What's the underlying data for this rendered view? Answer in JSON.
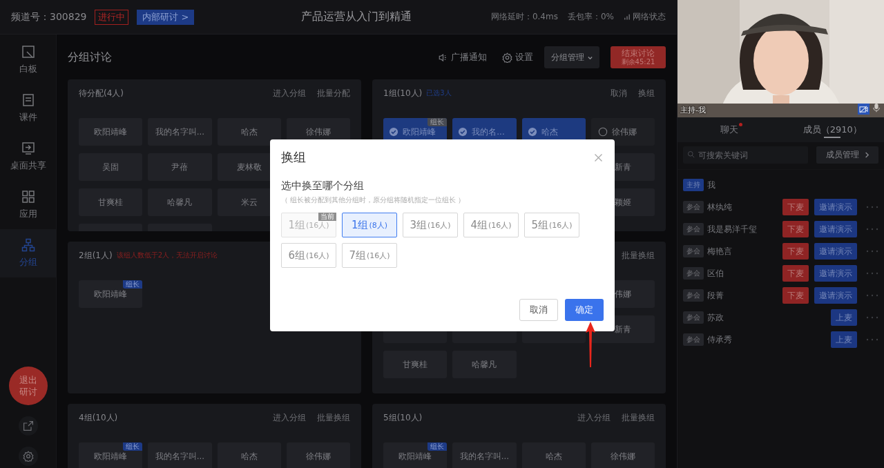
{
  "top_bar": {
    "channel": "频道号：300829",
    "status": "进行中",
    "meeting_tag": "内部研讨 >",
    "title": "产品运营从入门到精通",
    "latency": "网络延时：0.4ms",
    "packet_loss": "丢包率：0%",
    "network": "网络状态"
  },
  "sidebar": {
    "items": [
      {
        "kind": "whiteboard",
        "label": "白板",
        "selected": false
      },
      {
        "kind": "courseware",
        "label": "课件",
        "selected": false
      },
      {
        "kind": "screen-share",
        "label": "桌面共享",
        "selected": false
      },
      {
        "kind": "apps",
        "label": "应用",
        "selected": false
      },
      {
        "kind": "groups",
        "label": "分组",
        "selected": true
      }
    ],
    "exit_button": "退出研讨"
  },
  "header": {
    "title": "分组讨论",
    "broadcast": "广播通知",
    "settings": "设置",
    "group_menu": "分组管理",
    "end_button": "结束讨论",
    "remaining": "剩余45:21"
  },
  "groups": [
    {
      "title": "待分配(4人)",
      "actions": [
        "进入分组",
        "批量分配"
      ],
      "members": [
        {
          "kind": "plain",
          "name": "欧阳靖峰"
        },
        {
          "kind": "plain",
          "name": "我的名字叫..."
        },
        {
          "kind": "plain",
          "name": "哈杰"
        },
        {
          "kind": "plain",
          "name": "徐伟娜"
        },
        {
          "kind": "plain",
          "name": "吴固"
        },
        {
          "kind": "plain",
          "name": "尹蓓"
        },
        {
          "kind": "plain",
          "name": "麦林敬"
        },
        {
          "kind": "hidden"
        },
        {
          "kind": "plain",
          "name": "甘爽桂"
        },
        {
          "kind": "plain",
          "name": "哈馨凡"
        },
        {
          "kind": "plain",
          "name": "米云"
        },
        {
          "kind": "hidden"
        },
        {
          "kind": "blank"
        },
        {
          "kind": "blank"
        }
      ]
    },
    {
      "title": "1组(10人)",
      "note": "已选3人",
      "actions": [
        "取消",
        "换组"
      ],
      "members": [
        {
          "kind": "selectable",
          "name": "欧阳靖峰",
          "badge": "组长",
          "selected": true
        },
        {
          "kind": "selectable",
          "name": "我的名...",
          "selected": true
        },
        {
          "kind": "selectable",
          "name": "哈杰",
          "selected": true
        },
        {
          "kind": "selectable",
          "name": "徐伟娜",
          "selected": false
        },
        {
          "kind": "hidden"
        },
        {
          "kind": "hidden"
        },
        {
          "kind": "hidden"
        },
        {
          "kind": "plain",
          "name": "新青"
        },
        {
          "kind": "hidden"
        },
        {
          "kind": "hidden"
        },
        {
          "kind": "hidden"
        },
        {
          "kind": "plain",
          "name": "颖姬"
        }
      ]
    },
    {
      "title": "2组(1人)",
      "warning": "该组人数低于2人，无法开启讨论",
      "members": [
        {
          "kind": "plain",
          "name": "欧阳靖峰",
          "badge": "组长"
        }
      ]
    },
    {
      "actions": [
        "批量换组"
      ],
      "members": [
        {
          "kind": "hidden"
        },
        {
          "kind": "hidden"
        },
        {
          "kind": "hidden"
        },
        {
          "kind": "plain",
          "name": "伟娜"
        },
        {
          "kind": "covered"
        },
        {
          "kind": "covered"
        },
        {
          "kind": "covered"
        },
        {
          "kind": "plain",
          "name": "新青"
        },
        {
          "kind": "plain",
          "name": "甘爽桂"
        },
        {
          "kind": "plain",
          "name": "哈馨凡"
        }
      ]
    },
    {
      "title": "4组(10人)",
      "actions": [
        "进入分组",
        "批量换组"
      ],
      "members": [
        {
          "kind": "plain",
          "name": "欧阳靖峰",
          "badge": "组长"
        },
        {
          "kind": "plain",
          "name": "我的名字叫..."
        },
        {
          "kind": "plain",
          "name": "哈杰"
        },
        {
          "kind": "plain",
          "name": "徐伟娜"
        }
      ]
    },
    {
      "title": "5组(10人)",
      "actions": [
        "进入分组",
        "批量换组"
      ],
      "members": [
        {
          "kind": "plain",
          "name": "欧阳靖峰",
          "badge": "组长"
        },
        {
          "kind": "plain",
          "name": "我的名字叫..."
        },
        {
          "kind": "plain",
          "name": "哈杰"
        },
        {
          "kind": "plain",
          "name": "徐伟娜"
        }
      ]
    }
  ],
  "video": {
    "kind": "picture",
    "label": "主持-我"
  },
  "tabs": [
    {
      "label": "聊天",
      "unread": true,
      "selected": false
    },
    {
      "label": "成员（2910）",
      "unread": false,
      "selected": true
    }
  ],
  "member_search": {
    "placeholder": "可搜索关键词"
  },
  "member_manage": "成员管理",
  "members": [
    {
      "role": "主持",
      "kind": "host",
      "name": "我",
      "more": false
    },
    {
      "role": "参会",
      "kind": "attendee",
      "name": "林纨纯",
      "actions": [
        {
          "label": "下麦",
          "kind": "danger"
        },
        {
          "label": "邀请演示",
          "kind": "primary"
        }
      ],
      "more": true
    },
    {
      "role": "参会",
      "kind": "attendee",
      "name": "我是易洋千玺",
      "actions": [
        {
          "label": "下麦",
          "kind": "danger"
        },
        {
          "label": "邀请演示",
          "kind": "primary"
        }
      ],
      "more": true
    },
    {
      "role": "参会",
      "kind": "attendee",
      "name": "梅艳言",
      "actions": [
        {
          "label": "下麦",
          "kind": "danger"
        },
        {
          "label": "邀请演示",
          "kind": "primary"
        }
      ],
      "more": true
    },
    {
      "role": "参会",
      "kind": "attendee",
      "name": "区伯",
      "actions": [
        {
          "label": "下麦",
          "kind": "danger"
        },
        {
          "label": "邀请演示",
          "kind": "primary"
        }
      ],
      "more": true
    },
    {
      "role": "参会",
      "kind": "attendee",
      "name": "段菁",
      "actions": [
        {
          "label": "下麦",
          "kind": "danger"
        },
        {
          "label": "邀请演示",
          "kind": "primary"
        }
      ],
      "more": true
    },
    {
      "role": "参会",
      "kind": "attendee",
      "name": "苏政",
      "actions": [
        {
          "label": "上麦",
          "kind": "primary"
        }
      ],
      "more": true
    },
    {
      "role": "参会",
      "kind": "attendee",
      "name": "侍承秀",
      "actions": [
        {
          "label": "上麦",
          "kind": "primary"
        }
      ],
      "more": true
    }
  ],
  "modal": {
    "title": "换组",
    "prompt": "选中换至哪个分组",
    "note": "（ 组长被分配到其他分组时，原分组将随机指定一位组长 ）",
    "options": [
      {
        "label": "1组",
        "count": "(16人)",
        "tag": "当前",
        "disabled": true,
        "selected": false
      },
      {
        "label": "1组",
        "count": "(8人)",
        "disabled": false,
        "selected": true
      },
      {
        "label": "3组",
        "count": "(16人)",
        "disabled": false,
        "selected": false
      },
      {
        "label": "4组",
        "count": "(16人)",
        "disabled": false,
        "selected": false
      },
      {
        "label": "5组",
        "count": "(16人)",
        "disabled": false,
        "selected": false
      },
      {
        "label": "6组",
        "count": "(16人)",
        "disabled": false,
        "selected": false
      },
      {
        "label": "7组",
        "count": "(16人)",
        "disabled": false,
        "selected": false
      }
    ],
    "buttons": [
      {
        "label": "取消",
        "kind": "default"
      },
      {
        "label": "确定",
        "kind": "primary"
      }
    ]
  }
}
